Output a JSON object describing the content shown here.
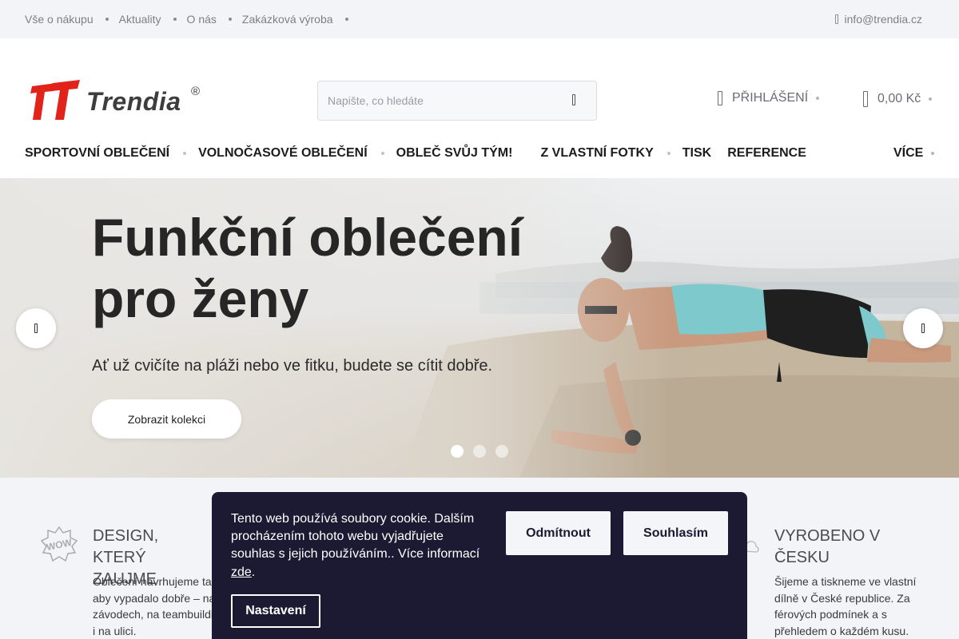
{
  "topbar": {
    "links": [
      "Vše o nákupu",
      "Aktuality",
      "O nás",
      "Zakázková výroba"
    ],
    "email": "info@trendia.cz"
  },
  "header": {
    "logo_text": "Trendia",
    "logo_reg": "®",
    "search_placeholder": "Napište, co hledáte",
    "login_label": "PŘIHLÁŠENÍ",
    "cart_total": "0,00 Kč"
  },
  "nav": {
    "items": [
      "SPORTOVNÍ OBLEČENÍ",
      "VOLNOČASOVÉ OBLEČENÍ",
      "OBLEČ SVŮJ TÝM!",
      "Z VLASTNÍ FOTKY",
      "TISK",
      "REFERENCE"
    ],
    "more_label": "VÍCE"
  },
  "hero": {
    "title": "Funkční oblečení pro ženy",
    "subtitle": "Ať už cvičíte na pláži nebo ve fitku, budete se cítit dobře.",
    "cta": "Zobrazit kolekci",
    "active_slide": 1,
    "slide_count": 3
  },
  "benefits": [
    {
      "icon": "wow-badge-icon",
      "title": "DESIGN, KTERÝ ZAUJME",
      "text": "Oblečení navrhujeme tak, aby vypadalo dobře – na závodech, na teambuildingu i na ulici."
    },
    {
      "icon": "cloud-icon",
      "title": "VYROBENO V ČESKU",
      "text": "Šijeme a tiskneme ve vlastní dílně v České republice. Za férových podmínek a s přehledem o každém kusu."
    }
  ],
  "cookie": {
    "text": "Tento web používá soubory cookie. Dalším procházením tohoto webu vyjadřujete souhlas s jejich používáním.. Více informací",
    "link": "zde",
    "link_suffix": ".",
    "refuse": "Odmítnout",
    "accept": "Souhlasím",
    "settings": "Nastavení"
  },
  "colors": {
    "brand_red": "#e2231a",
    "cookie_bg": "#1c1a33",
    "topbar_bg": "#f3f4f7"
  }
}
